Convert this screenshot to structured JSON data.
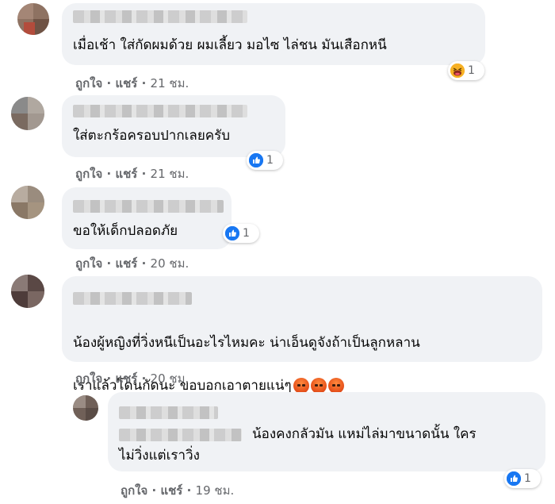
{
  "comments": [
    {
      "text": "เมื่อเช้า ใส่กัดผมด้วย ผมเลี้ยว มอไซ ไล่ชน มันเสือกหนี",
      "actions": {
        "like": "ถูกใจ",
        "sep": "·",
        "share": "แชร์",
        "time": "21 ชม."
      },
      "reaction": {
        "icon": "haha-icon",
        "count": "1"
      }
    },
    {
      "text": "ใส่ตะกร้อครอบปากเลยครับ",
      "actions": {
        "like": "ถูกใจ",
        "sep": "·",
        "share": "แชร์",
        "time": "21 ชม."
      },
      "reaction": {
        "icon": "like-icon",
        "count": "1"
      }
    },
    {
      "text": "ขอให้เด็กปลอดภัย",
      "actions": {
        "like": "ถูกใจ",
        "sep": "·",
        "share": "แชร์",
        "time": "20 ชม."
      },
      "reaction": {
        "icon": "like-icon",
        "count": "1"
      }
    },
    {
      "text_line1": "น้องผู้หญิงที่วิ่งหนีเป็นอะไรไหมคะ น่าเอ็นดูจังถ้าเป็นลูกหลาน",
      "text_line2": "เราแล้วโดนกัดนะ ขอบอกเอาตายแน่ๆ",
      "emojis": [
        "angry-emoji",
        "angry-emoji",
        "angry-emoji"
      ],
      "actions": {
        "like": "ถูกใจ",
        "sep": "·",
        "share": "แชร์",
        "time": "20 ชม."
      }
    },
    {
      "text_line1": "น้องคงกลัวมัน แหม่ไล่มาขนาดนั้น ใคร",
      "text_line2": "ไม่วิ่งแต่เราวิ่ง",
      "actions": {
        "like": "ถูกใจ",
        "sep": "·",
        "share": "แชร์",
        "time": "19 ชม."
      },
      "reaction": {
        "icon": "like-icon",
        "count": "1"
      }
    }
  ],
  "colors": {
    "bubble": "#f0f2f5",
    "meta": "#65676b",
    "like": "#1877f2"
  }
}
